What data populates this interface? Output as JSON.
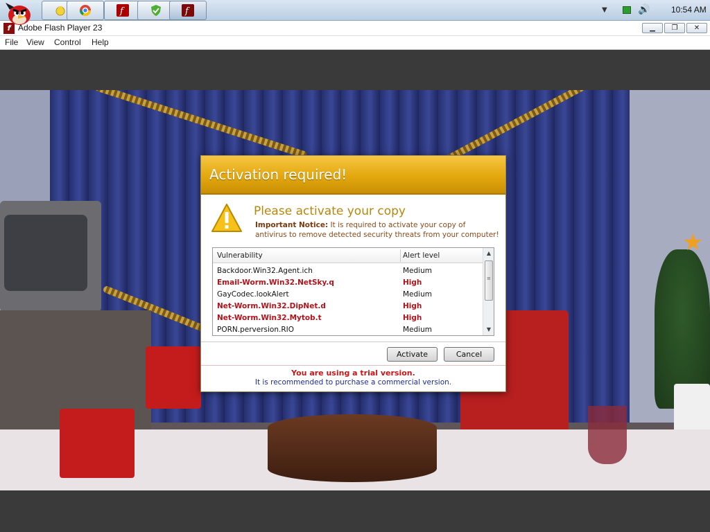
{
  "taskbar": {
    "pinned": [
      {
        "icon": "angry-bird-start-icon"
      },
      {
        "icon": "folder-icon"
      },
      {
        "icon": "chrome-icon"
      },
      {
        "icon": "flash-icon"
      },
      {
        "icon": "shield-check-icon"
      },
      {
        "icon": "flash-player-icon"
      }
    ],
    "tray": {
      "overflow_icon": "chevron-down-icon",
      "network_icon": "network-icon",
      "volume_icon": "speaker-icon"
    },
    "clock": "10:54 AM"
  },
  "window": {
    "title": "Adobe Flash Player 23",
    "menu": [
      "File",
      "View",
      "Control",
      "Help"
    ]
  },
  "dialog": {
    "title": "Activation required!",
    "heading": "Please activate your copy",
    "notice_label": "Important Notice:",
    "notice_text": " It is required to activate your copy of antivirus to remove detected security threats from your computer!",
    "columns": [
      "Vulnerability",
      "Alert level"
    ],
    "rows": [
      {
        "name": "Backdoor.Win32.Agent.ich",
        "level": "Medium",
        "severity": "medium"
      },
      {
        "name": "Email-Worm.Win32.NetSky.q",
        "level": "High",
        "severity": "high"
      },
      {
        "name": "GayCodec.lookAlert",
        "level": "Medium",
        "severity": "medium"
      },
      {
        "name": "Net-Worm.Win32.DipNet.d",
        "level": "High",
        "severity": "high"
      },
      {
        "name": "Net-Worm.Win32.Mytob.t",
        "level": "High",
        "severity": "high"
      },
      {
        "name": "PORN.perversion.RIO",
        "level": "Medium",
        "severity": "medium"
      }
    ],
    "activate_label": "Activate",
    "cancel_label": "Cancel",
    "trial_text": "You are using a trial version.",
    "recommend_text": "It is recommended to purchase a commercial version."
  },
  "colors": {
    "header_gold": "#e3a80e",
    "heading_gold": "#b8860b",
    "high_alert": "#b4121b",
    "trial_red": "#c41818",
    "recommend_blue": "#1a2a9a"
  }
}
